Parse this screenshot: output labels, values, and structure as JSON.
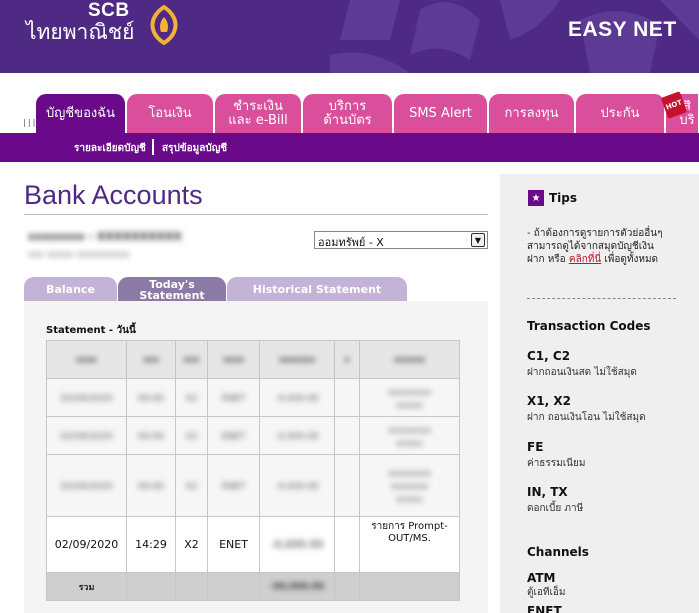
{
  "header": {
    "logo_en": "SCB",
    "logo_th": "ไทยพาณิชย์",
    "product": "EASY NET",
    "brand_color": "#4e2a84"
  },
  "nav": {
    "tabs": [
      {
        "label": "บัญชีของฉัน",
        "active": true
      },
      {
        "label": "โอนเงิน"
      },
      {
        "label": "ชำระเงิน และ e-Bill"
      },
      {
        "label": "บริการ ด้านบัตร"
      },
      {
        "label": "SMS Alert"
      },
      {
        "label": "การลงทุน"
      },
      {
        "label": "ประกัน"
      },
      {
        "label": "สิ บริ"
      }
    ],
    "hot_badge": "HOT",
    "subnav": [
      "รายละเอียดบัญชี",
      "สรุปข้อมูลบัญชี"
    ]
  },
  "main": {
    "title": "Bank Accounts",
    "account_select": "ออมทรัพย์ - X",
    "statement_tabs": [
      "Balance",
      "Today's Statement",
      "Historical Statement"
    ],
    "statement_label": "Statement - วันนี้",
    "table": {
      "visible_row": {
        "date": "02/09/2020",
        "time": "14:29",
        "code": "X2",
        "channel": "ENET",
        "description": "รายการ Prompt- OUT/MS."
      },
      "total_label": "รวม"
    }
  },
  "sidebar": {
    "tips_title": "Tips",
    "tips_text_1": "- ถ้าต้องการดูรายการตัวย่ออื่นๆ สามารถดูได้จากสมุดบัญชีเงินฝาก หรือ",
    "tips_link": "คลิกที่นี่",
    "tips_text_2": "เพื่อดูทั้งหมด",
    "transaction_codes_title": "Transaction Codes",
    "codes": [
      {
        "code": "C1, C2",
        "desc": "ฝากถอนเงินสด ไม่ใช้สมุด"
      },
      {
        "code": "X1, X2",
        "desc": "ฝาก ถอนเงินโอน ไม่ใช้สมุด"
      },
      {
        "code": "FE",
        "desc": "ค่าธรรมเนียม"
      },
      {
        "code": "IN, TX",
        "desc": "ดอกเบี้ย ภาษี"
      }
    ],
    "channels_title": "Channels",
    "channels": [
      {
        "code": "ATM",
        "desc": "ตู้เอทีเอ็ม"
      },
      {
        "code": "ENET",
        "desc": ""
      }
    ]
  }
}
